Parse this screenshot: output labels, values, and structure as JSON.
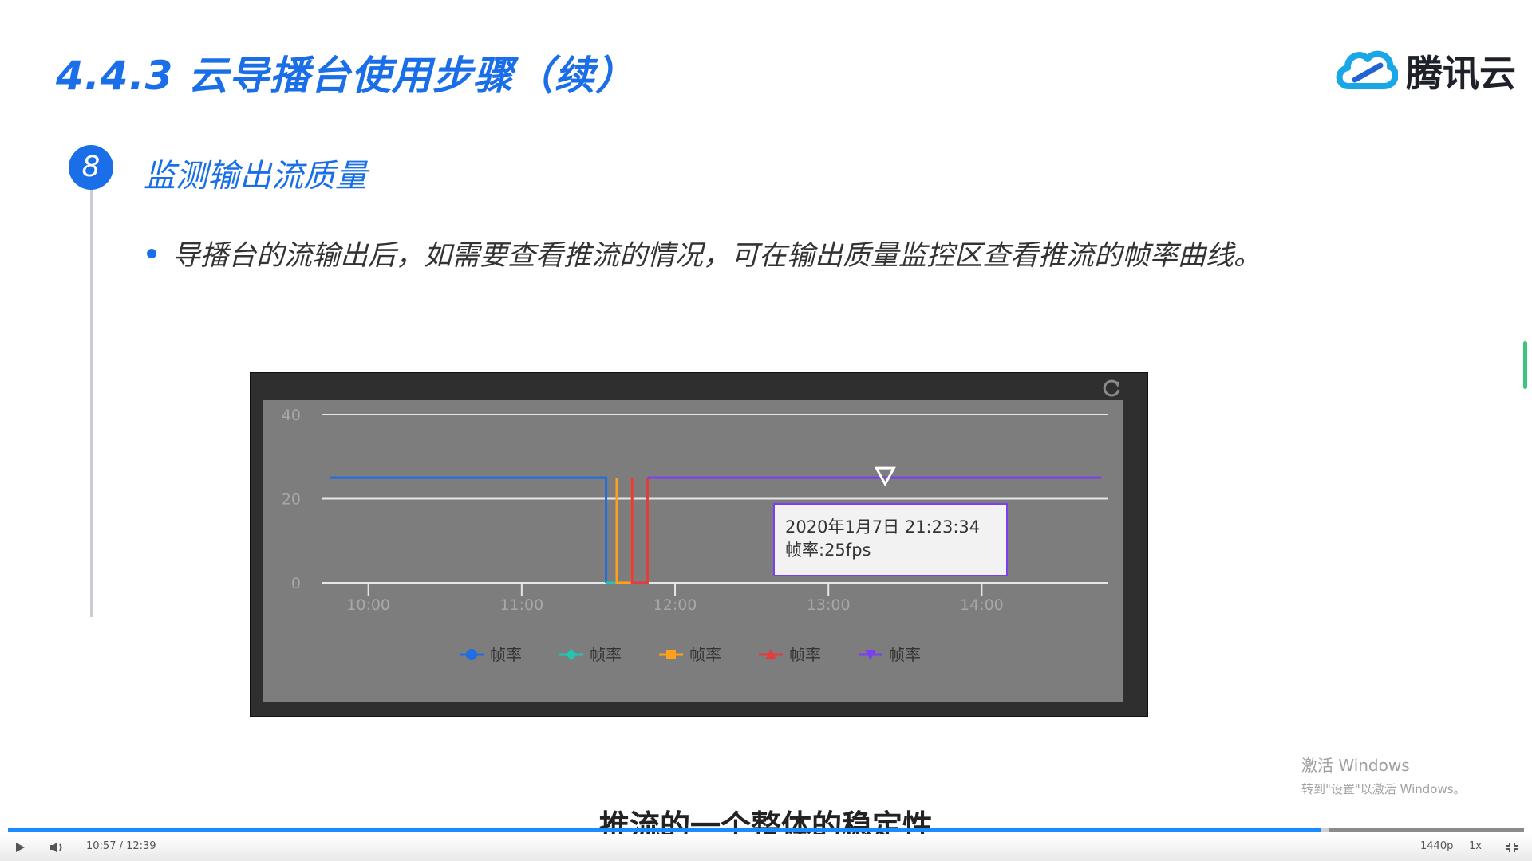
{
  "slide": {
    "title": "4.4.3 云导播台使用步骤（续）",
    "logo_text": "腾讯云",
    "step_number": "8",
    "step_title": "监测输出流质量",
    "bullet": "导播台的流输出后，如需要查看推流的情况，可在输出质量监控区查看推流的帧率曲线。"
  },
  "chart_data": {
    "type": "line",
    "y_ticks": [
      "40",
      "20",
      "0"
    ],
    "ylim": [
      0,
      40
    ],
    "x_ticks": [
      "10:00",
      "11:00",
      "12:00",
      "13:00",
      "14:00"
    ],
    "series": [
      {
        "name": "帧率",
        "color": "#1f6fe0",
        "marker": "circle",
        "x": [
          9.75,
          11.55,
          11.55
        ],
        "y": [
          25,
          25,
          0
        ]
      },
      {
        "name": "帧率",
        "color": "#1ec8b4",
        "marker": "diamond",
        "x": [
          11.55,
          11.62,
          11.62
        ],
        "y": [
          0,
          0,
          25
        ]
      },
      {
        "name": "帧率",
        "color": "#ff9f1a",
        "marker": "square",
        "x": [
          11.62,
          11.62,
          11.72,
          11.72
        ],
        "y": [
          25,
          0,
          0,
          25
        ]
      },
      {
        "name": "帧率",
        "color": "#e23c3c",
        "marker": "triangle",
        "x": [
          11.72,
          11.72,
          11.82,
          11.82
        ],
        "y": [
          25,
          0,
          0,
          25
        ]
      },
      {
        "name": "帧率",
        "color": "#7a3ff0",
        "marker": "triangle-down",
        "x": [
          11.82,
          14.78
        ],
        "y": [
          25,
          25
        ]
      }
    ],
    "tooltip": {
      "time": "2020年1月7日 21:23:34",
      "value": "帧率:25fps",
      "x": 13.37,
      "y": 25
    },
    "grid": true,
    "legend": "bottom"
  },
  "watermark": {
    "title": "激活 Windows",
    "sub": "转到\"设置\"以激活 Windows。"
  },
  "video": {
    "subtitle": "推流的一个整体的稳定性",
    "time": "10:57 / 12:39",
    "played_fraction": 0.866,
    "quality": "1440p",
    "speed": "1x"
  }
}
